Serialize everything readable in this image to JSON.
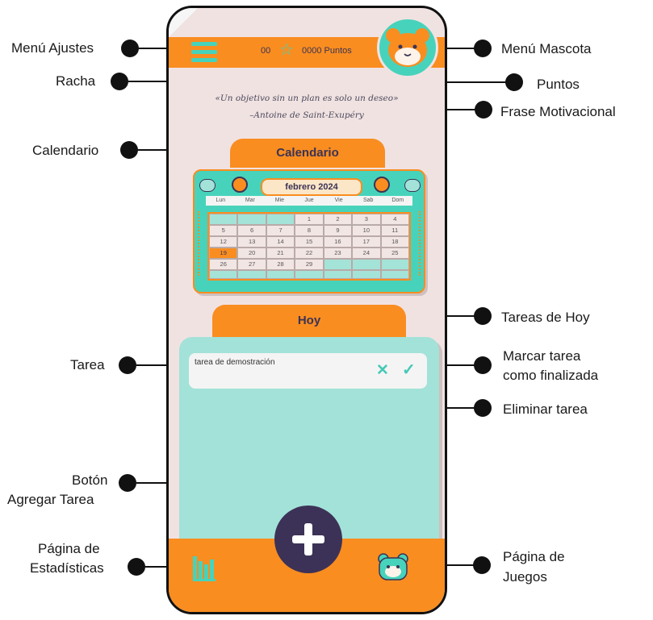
{
  "labels": {
    "menu_ajustes": "Menú Ajustes",
    "racha": "Racha",
    "calendario": "Calendario",
    "tarea": "Tarea",
    "boton_line1": "Botón",
    "boton_line2": "Agregar Tarea",
    "estadisticas_line1": "Página de",
    "estadisticas_line2": "Estadísticas",
    "menu_mascota": "Menú Mascota",
    "puntos": "Puntos",
    "frase": "Frase Motivacional",
    "tareas_hoy": "Tareas de Hoy",
    "marcar_line1": "Marcar tarea",
    "marcar_line2": "como finalizada",
    "eliminar": "Eliminar tarea",
    "juegos_line1": "Página de",
    "juegos_line2": "Juegos"
  },
  "app": {
    "streak": "00",
    "points": "0000 Puntos",
    "quote_line1": "«Un objetivo sin un plan es solo un deseo»",
    "quote_line2": "–Antoine de Saint-Exupéry",
    "calendar_tab": "Calendario",
    "month": "febrero 2024",
    "weekdays": [
      "Lun",
      "Mar",
      "Mie",
      "Jue",
      "Vie",
      "Sab",
      "Dom"
    ],
    "calendar_cells": [
      "",
      "",
      "",
      "1",
      "2",
      "3",
      "4",
      "5",
      "6",
      "7",
      "8",
      "9",
      "10",
      "11",
      "12",
      "13",
      "14",
      "15",
      "16",
      "17",
      "18",
      "19",
      "20",
      "21",
      "22",
      "23",
      "24",
      "25",
      "26",
      "27",
      "28",
      "29",
      "",
      "",
      "",
      "",
      "",
      "",
      "",
      "",
      "",
      ""
    ],
    "today": "19",
    "today_tab": "Hoy",
    "task_text": "tarea de demostración"
  },
  "icons": {
    "menu": "hamburger-menu-icon",
    "streak": "star-icon",
    "pet": "hamster-avatar-icon",
    "delete": "x-icon",
    "done": "checkmark-icon",
    "add": "plus-icon",
    "stats": "bar-chart-icon",
    "games": "hamster-game-icon"
  },
  "colors": {
    "orange": "#f98d20",
    "teal": "#47d3bb",
    "light_teal": "#a3e2d8",
    "background": "#f1e2e2",
    "dark_purple": "#3c3257"
  }
}
